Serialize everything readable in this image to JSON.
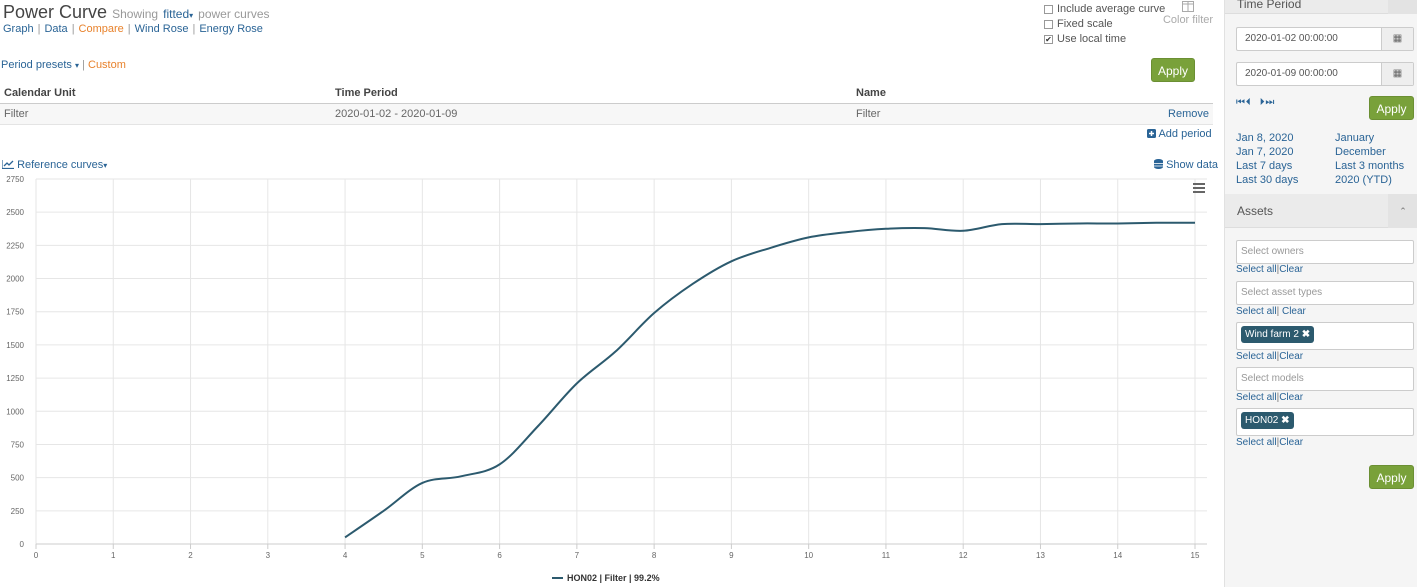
{
  "header": {
    "title": "Power Curve",
    "showing": "Showing",
    "mode": "fitted",
    "suffix": "power curves"
  },
  "nav": [
    "Graph",
    "Data",
    "Compare",
    "Wind Rose",
    "Energy Rose"
  ],
  "nav_active": "Compare",
  "options": {
    "include_average": {
      "label": "Include average curve",
      "checked": false
    },
    "fixed_scale": {
      "label": "Fixed scale",
      "checked": false
    },
    "use_local_time": {
      "label": "Use local time",
      "checked": true
    }
  },
  "color_filter": "Color filter",
  "apply_label": "Apply",
  "presets": {
    "label": "Period presets",
    "custom": "Custom"
  },
  "periods_table": {
    "headers": [
      "Calendar Unit",
      "Time Period",
      "Name"
    ],
    "rows": [
      {
        "unit": "Filter",
        "period": "2020-01-02 - 2020-01-09",
        "name": "Filter",
        "action": "Remove"
      }
    ],
    "add_period": "Add period"
  },
  "chart_controls": {
    "reference_curves": "Reference curves",
    "show_data": "Show data"
  },
  "chart_data": {
    "type": "line",
    "xlim": [
      0,
      15
    ],
    "ylim": [
      0,
      2750
    ],
    "xticks": [
      "0",
      "1",
      "2",
      "3",
      "4",
      "5",
      "6",
      "7",
      "8",
      "9",
      "10",
      "11",
      "12",
      "13",
      "14",
      "15"
    ],
    "yticks": [
      "0",
      "250",
      "500",
      "750",
      "1000",
      "1250",
      "1500",
      "1750",
      "2000",
      "2250",
      "2500",
      "2750"
    ],
    "grid": true,
    "legend": "bottom-center",
    "series": [
      {
        "name": "HON02 | Filter | 99.2%",
        "color": "#2c5a6e",
        "x": [
          4,
          4.5,
          5,
          5.5,
          6,
          6.5,
          7,
          7.5,
          8,
          8.5,
          9,
          9.5,
          10,
          10.5,
          11,
          11.5,
          12,
          12.5,
          13,
          13.5,
          14,
          14.5,
          15
        ],
        "y": [
          50,
          250,
          460,
          510,
          600,
          890,
          1210,
          1450,
          1740,
          1960,
          2130,
          2230,
          2310,
          2350,
          2375,
          2380,
          2360,
          2410,
          2410,
          2415,
          2415,
          2420,
          2420
        ]
      }
    ]
  },
  "time_period": {
    "heading": "Time Period",
    "start": "2020-01-02 00:00:00",
    "end": "2020-01-09 00:00:00",
    "apply": "Apply",
    "quick_left": [
      "Jan 8, 2020",
      "Jan 7, 2020",
      "Last 7 days",
      "Last 30 days"
    ],
    "quick_right": [
      "January",
      "December",
      "Last 3 months",
      "2020 (YTD)"
    ]
  },
  "assets": {
    "heading": "Assets",
    "owners_placeholder": "Select owners",
    "types_placeholder": "Select asset types",
    "farm_tag": "Wind farm 2",
    "models_placeholder": "Select models",
    "turbine_tag": "HON02",
    "select_all": "Select all",
    "clear": "Clear",
    "apply": "Apply"
  }
}
